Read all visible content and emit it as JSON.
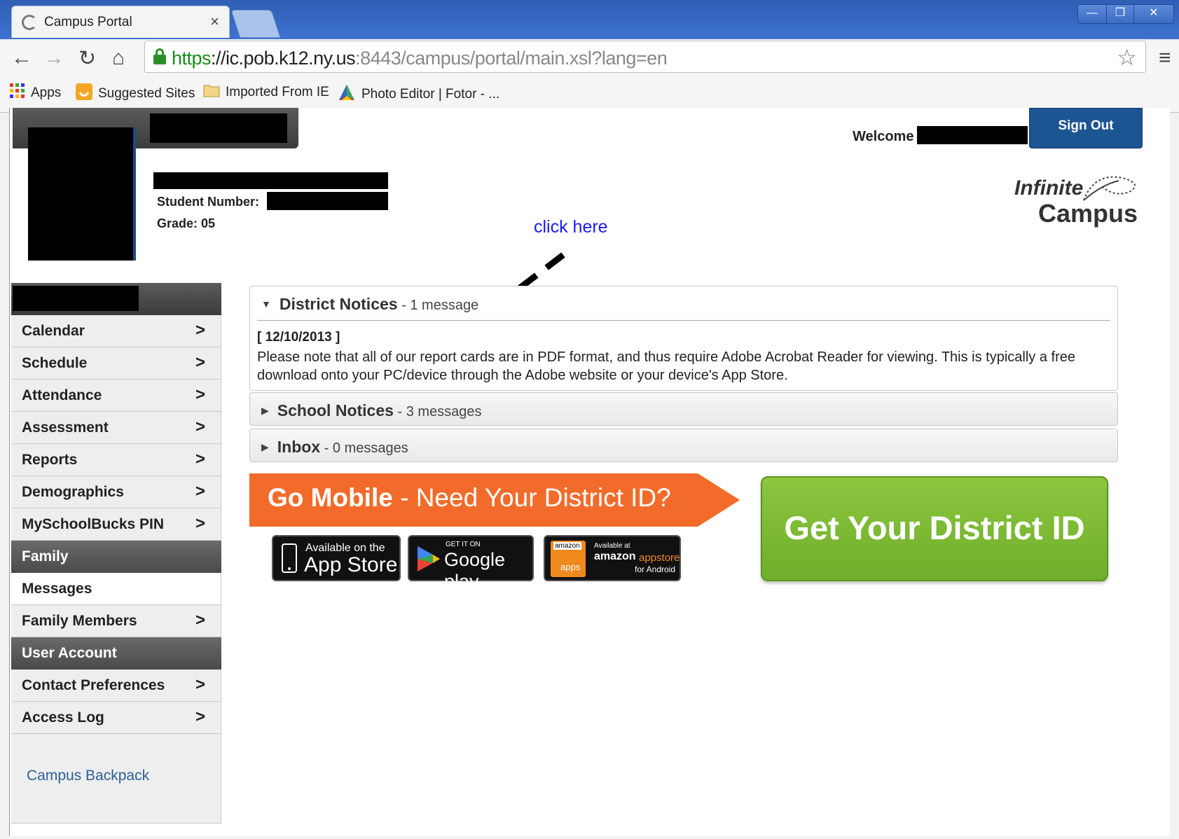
{
  "browser": {
    "tab_title": "Campus Portal",
    "tab_close": "×",
    "url_scheme": "https",
    "url_host": "://ic.pob.k12.ny.us",
    "url_port": ":8443",
    "url_path": "/campus/portal/main.xsl?lang=en",
    "bookmarks": [
      "Apps",
      "Suggested Sites",
      "Imported From IE",
      "Photo Editor | Fotor - ..."
    ]
  },
  "header": {
    "welcome_label": "Welcome",
    "sign_out_label": "Sign Out",
    "student_number_label": "Student Number:",
    "grade_label": "Grade: 05",
    "logo_line1": "Infinite",
    "logo_line2": "Campus"
  },
  "annotation": {
    "text": "click here"
  },
  "sidebar": {
    "items": [
      {
        "label": "Calendar",
        "chevron": ">"
      },
      {
        "label": "Schedule",
        "chevron": ">"
      },
      {
        "label": "Attendance",
        "chevron": ">"
      },
      {
        "label": "Assessment",
        "chevron": ">"
      },
      {
        "label": "Reports",
        "chevron": ">"
      },
      {
        "label": "Demographics",
        "chevron": ">"
      },
      {
        "label": "MySchoolBucks PIN",
        "chevron": ">"
      }
    ],
    "family_header": "Family",
    "messages_label": "Messages",
    "family_members_label": "Family Members",
    "user_account_header": "User Account",
    "contact_preferences_label": "Contact Preferences",
    "access_log_label": "Access Log",
    "chevron": ">",
    "campus_backpack_link": "Campus Backpack"
  },
  "notices": {
    "district": {
      "title": "District Notices",
      "count": " - 1 message",
      "date": "[ 12/10/2013 ]",
      "text": "Please note that all of our report cards are in PDF format, and thus require Adobe Acrobat Reader for viewing.  This is typically a free download onto your PC/device through the Adobe website or your device's App Store."
    },
    "school": {
      "title": "School Notices",
      "count": " - 3 messages"
    },
    "inbox": {
      "title": "Inbox",
      "count": " - 0 messages"
    }
  },
  "promo": {
    "go_mobile_bold": "Go Mobile",
    "go_mobile_rest": " - Need Your District ID?",
    "appstore_small": "Available on the",
    "appstore_big": "App Store",
    "googleplay_small": "GET IT ON",
    "googleplay_big": "Google play",
    "amazon_logo": "amazon",
    "amazon_apps": "apps",
    "amazon_small": "Available at",
    "amazon_big_1": "amazon",
    "amazon_big_2": "appstore",
    "amazon_for": "for Android",
    "get_district_id": "Get Your District ID"
  },
  "colors": {
    "sign_out_bg": "#1d5592",
    "orange_banner": "#f26b2a",
    "green_button": "#7dbb34",
    "annotation_blue": "#1a1aff"
  }
}
